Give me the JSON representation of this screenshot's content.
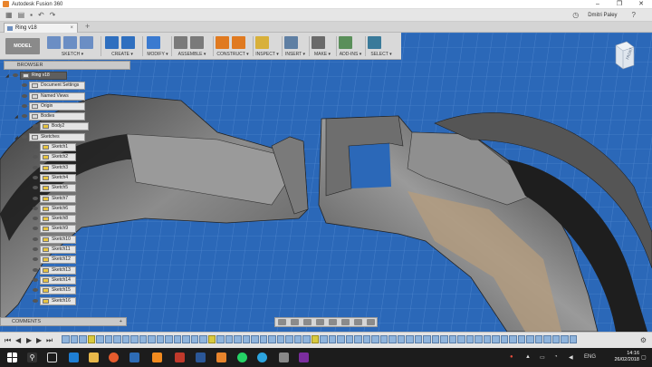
{
  "window": {
    "title": "Autodesk Fusion 360",
    "min": "–",
    "max": "❐",
    "close": "✕"
  },
  "quick_access": {
    "user": "Dmitri Paley",
    "help": "?"
  },
  "doc_tab": {
    "label": "Ring v18",
    "close": "×",
    "add": "+"
  },
  "toolbar": {
    "mode": "MODEL",
    "groups": [
      {
        "label": "SKETCH ▾",
        "icon": "sketch-icon",
        "color": "#6b8ec4"
      },
      {
        "label": "CREATE ▾",
        "icon": "create-icon",
        "color": "#2f6fbf"
      },
      {
        "label": "MODIFY ▾",
        "icon": "modify-icon",
        "color": "#3a7ad0"
      },
      {
        "label": "ASSEMBLE ▾",
        "icon": "assemble-icon",
        "color": "#7a7a7a"
      },
      {
        "label": "CONSTRUCT ▾",
        "icon": "construct-icon",
        "color": "#e07a20"
      },
      {
        "label": "INSPECT ▾",
        "icon": "inspect-icon",
        "color": "#d8b03a"
      },
      {
        "label": "INSERT ▾",
        "icon": "insert-icon",
        "color": "#5f7fa3"
      },
      {
        "label": "MAKE ▾",
        "icon": "make-icon",
        "color": "#6a6a6a"
      },
      {
        "label": "ADD-INS ▾",
        "icon": "addins-icon",
        "color": "#5a8f5a"
      },
      {
        "label": "SELECT ▾",
        "icon": "select-icon",
        "color": "#3a7a9a"
      }
    ]
  },
  "browser": {
    "title": "BROWSER",
    "items": [
      {
        "label": "Ring v18",
        "dark": true
      },
      {
        "label": "Document Settings"
      },
      {
        "label": "Named Views"
      },
      {
        "label": "Origin"
      },
      {
        "label": "Bodies"
      },
      {
        "label": "Body2"
      },
      {
        "label": "Sketches"
      },
      {
        "label": "Sketch1"
      },
      {
        "label": "Sketch2"
      },
      {
        "label": "Sketch3"
      },
      {
        "label": "Sketch4"
      },
      {
        "label": "Sketch5"
      },
      {
        "label": "Sketch7"
      },
      {
        "label": "Sketch6"
      },
      {
        "label": "Sketch8"
      },
      {
        "label": "Sketch9"
      },
      {
        "label": "Sketch10"
      },
      {
        "label": "Sketch11"
      },
      {
        "label": "Sketch12"
      },
      {
        "label": "Sketch13"
      },
      {
        "label": "Sketch14"
      },
      {
        "label": "Sketch15"
      },
      {
        "label": "Sketch16"
      }
    ]
  },
  "comments": {
    "title": "COMMENTS",
    "add": "+"
  },
  "viewcube": {
    "face": "FRONT"
  },
  "taskbar": {
    "lang": "ENG",
    "time": "14:16",
    "date": "26/02/2018"
  },
  "colors": {
    "accent": "#2b68b8",
    "toolbar": "#d9d9d9"
  }
}
